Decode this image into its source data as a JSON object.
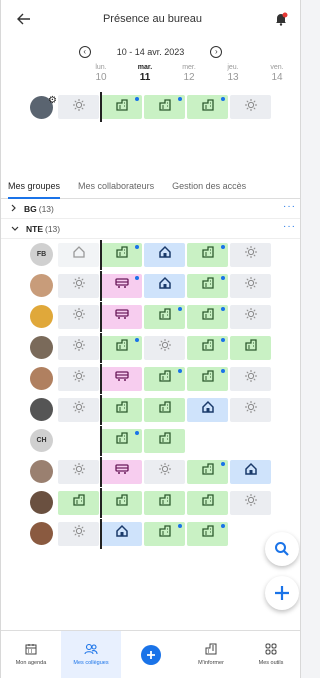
{
  "header": {
    "title": "Présence au bureau"
  },
  "week": {
    "range": "10 - 14 avr. 2023",
    "prev_icon": "chevron-left-icon",
    "next_icon": "chevron-right-icon"
  },
  "days": [
    {
      "name": "lun.",
      "num": "10",
      "today": false
    },
    {
      "name": "mar.",
      "num": "11",
      "today": true
    },
    {
      "name": "mer.",
      "num": "12",
      "today": false
    },
    {
      "name": "jeu.",
      "num": "13",
      "today": false
    },
    {
      "name": "ven.",
      "num": "14",
      "today": false
    }
  ],
  "me": {
    "cells": [
      "off",
      "office*",
      "office*",
      "office*",
      "off"
    ]
  },
  "tabs": [
    "Mes groupes",
    "Mes collaborateurs",
    "Gestion des accès"
  ],
  "groups": [
    {
      "name": "BG",
      "count": "(13)",
      "expanded": false,
      "more": "···"
    },
    {
      "name": "NTE",
      "count": "(13)",
      "expanded": true,
      "more": "···"
    }
  ],
  "people": [
    {
      "initials": "FB",
      "avatar_color": "#d0d0d0",
      "cells": [
        "officelight-home",
        "office*",
        "home",
        "office*",
        "off"
      ]
    },
    {
      "initials": "",
      "avatar_color": "#c89c7a",
      "cells": [
        "off",
        "travel*",
        "home",
        "office*",
        "off"
      ]
    },
    {
      "initials": "",
      "avatar_color": "#e0a83a",
      "cells": [
        "off",
        "travel",
        "office*",
        "office*",
        "off"
      ]
    },
    {
      "initials": "",
      "avatar_color": "#7a6a5a",
      "cells": [
        "off",
        "office*",
        "off",
        "office*",
        "office"
      ]
    },
    {
      "initials": "",
      "avatar_color": "#b08060",
      "cells": [
        "off",
        "travel",
        "office*",
        "office*",
        "off"
      ]
    },
    {
      "initials": "",
      "avatar_color": "#555555",
      "cells": [
        "off",
        "office",
        "office",
        "home",
        "off"
      ]
    },
    {
      "initials": "CH",
      "avatar_color": "#d0d0d0",
      "cells": [
        "empty",
        "office*",
        "office",
        "empty",
        "empty"
      ]
    },
    {
      "initials": "",
      "avatar_color": "#9a8070",
      "cells": [
        "off",
        "travel",
        "off",
        "office*",
        "home"
      ]
    },
    {
      "initials": "",
      "avatar_color": "#6a5040",
      "cells": [
        "office",
        "office",
        "office",
        "office",
        "off"
      ]
    },
    {
      "initials": "",
      "avatar_color": "#8a5a40",
      "cells": [
        "off",
        "home",
        "office*",
        "office*",
        "empty"
      ]
    }
  ],
  "bottom_nav": [
    {
      "label": "Mon agenda",
      "icon": "calendar-icon",
      "active": false
    },
    {
      "label": "Mes collègues",
      "icon": "people-icon",
      "active": true
    },
    {
      "label": "",
      "icon": "plus-icon",
      "active": false
    },
    {
      "label": "M'informer",
      "icon": "building-icon",
      "active": false
    },
    {
      "label": "Mes outils",
      "icon": "grid-icon",
      "active": false
    }
  ],
  "colors": {
    "accent": "#1a73e8",
    "office": "#c9f1c4",
    "home": "#cfe3fb",
    "travel": "#f7cdef",
    "off": "#ebedf1"
  }
}
